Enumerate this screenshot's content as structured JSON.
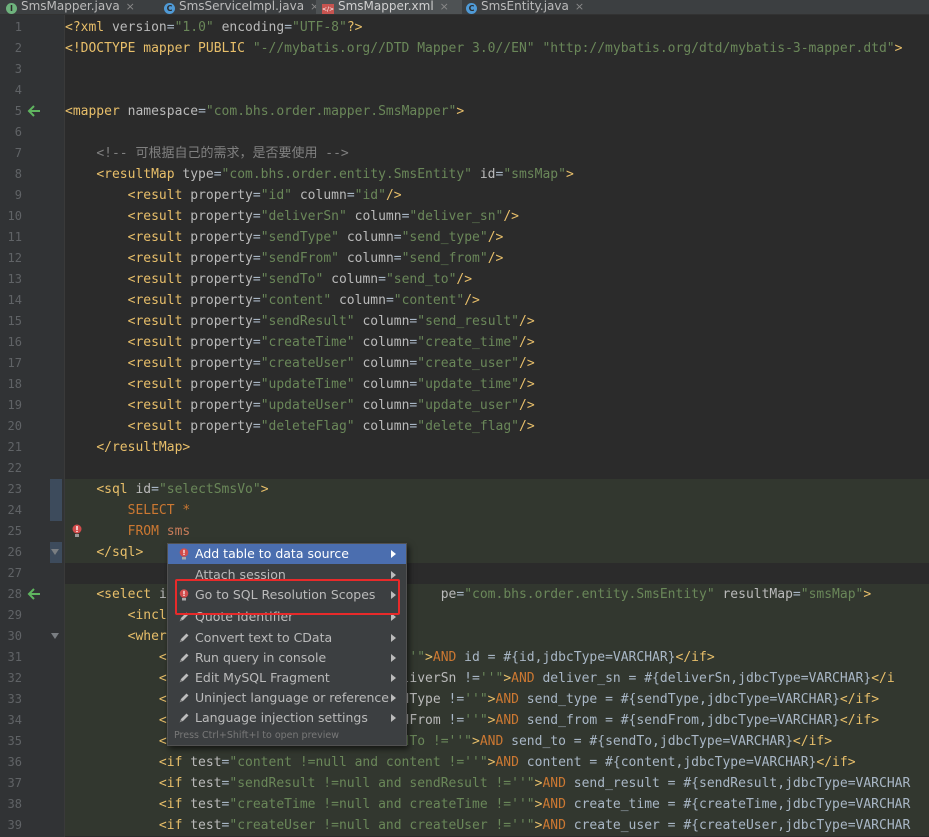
{
  "tabs": [
    {
      "label": "SmsMapper.java",
      "icon": "interface-icon",
      "icon_color": "#6eb37d",
      "icon_letter": "I",
      "active": false
    },
    {
      "label": "SmsServiceImpl.java",
      "icon": "class-icon",
      "icon_color": "#4f9ad6",
      "icon_letter": "C",
      "active": false
    },
    {
      "label": "SmsMapper.xml",
      "icon": "xml-file-icon",
      "icon_color": "#c75450",
      "icon_letter": "</>",
      "active": true
    },
    {
      "label": "SmsEntity.java",
      "icon": "class-icon",
      "icon_color": "#4f9ad6",
      "icon_letter": "C",
      "active": false
    }
  ],
  "line_numbers": [
    "1",
    "2",
    "3",
    "4",
    "5",
    "6",
    "7",
    "8",
    "9",
    "10",
    "11",
    "12",
    "13",
    "14",
    "15",
    "16",
    "17",
    "18",
    "19",
    "20",
    "21",
    "22",
    "23",
    "24",
    "25",
    "26",
    "27",
    "28",
    "29",
    "30",
    "31",
    "32",
    "33",
    "34",
    "35",
    "36",
    "37",
    "38",
    "39"
  ],
  "code_lines": [
    [
      [
        "t-tag",
        "<?xml "
      ],
      [
        "t-attr",
        "version"
      ],
      [
        "t-pl",
        "="
      ],
      [
        "t-val",
        "\"1.0\""
      ],
      [
        "t-pl",
        " "
      ],
      [
        "t-attr",
        "encoding"
      ],
      [
        "t-pl",
        "="
      ],
      [
        "t-val",
        "\"UTF-8\""
      ],
      [
        "t-tag",
        "?>"
      ]
    ],
    [
      [
        "t-tag",
        "<!DOCTYPE mapper PUBLIC "
      ],
      [
        "t-val",
        "\"-//mybatis.org//DTD Mapper 3.0//EN\""
      ],
      [
        "t-pl",
        " "
      ],
      [
        "t-val",
        "\"http://mybatis.org/dtd/mybatis-3-mapper.dtd\""
      ],
      [
        "t-tag",
        ">"
      ]
    ],
    [],
    [],
    [
      [
        "t-tag",
        "<mapper "
      ],
      [
        "t-attr",
        "namespace"
      ],
      [
        "t-pl",
        "="
      ],
      [
        "t-val",
        "\"com.bhs.order.mapper.SmsMapper\""
      ],
      [
        "t-tag",
        ">"
      ]
    ],
    [],
    [
      [
        "t-pl",
        "    "
      ],
      [
        "t-com",
        "<!-- 可根据自己的需求，是否要使用 -->"
      ]
    ],
    [
      [
        "t-pl",
        "    "
      ],
      [
        "t-tag",
        "<resultMap "
      ],
      [
        "t-attr",
        "type"
      ],
      [
        "t-pl",
        "="
      ],
      [
        "t-val",
        "\"com.bhs.order.entity.SmsEntity\""
      ],
      [
        "t-pl",
        " "
      ],
      [
        "t-attr",
        "id"
      ],
      [
        "t-pl",
        "="
      ],
      [
        "t-val",
        "\"smsMap\""
      ],
      [
        "t-tag",
        ">"
      ]
    ],
    [
      [
        "t-pl",
        "        "
      ],
      [
        "t-tag",
        "<result "
      ],
      [
        "t-attr",
        "property"
      ],
      [
        "t-pl",
        "="
      ],
      [
        "t-val",
        "\"id\""
      ],
      [
        "t-pl",
        " "
      ],
      [
        "t-attr",
        "column"
      ],
      [
        "t-pl",
        "="
      ],
      [
        "t-val",
        "\"id\""
      ],
      [
        "t-tag",
        "/>"
      ]
    ],
    [
      [
        "t-pl",
        "        "
      ],
      [
        "t-tag",
        "<result "
      ],
      [
        "t-attr",
        "property"
      ],
      [
        "t-pl",
        "="
      ],
      [
        "t-val",
        "\"deliverSn\""
      ],
      [
        "t-pl",
        " "
      ],
      [
        "t-attr",
        "column"
      ],
      [
        "t-pl",
        "="
      ],
      [
        "t-val",
        "\"deliver_sn\""
      ],
      [
        "t-tag",
        "/>"
      ]
    ],
    [
      [
        "t-pl",
        "        "
      ],
      [
        "t-tag",
        "<result "
      ],
      [
        "t-attr",
        "property"
      ],
      [
        "t-pl",
        "="
      ],
      [
        "t-val",
        "\"sendType\""
      ],
      [
        "t-pl",
        " "
      ],
      [
        "t-attr",
        "column"
      ],
      [
        "t-pl",
        "="
      ],
      [
        "t-val",
        "\"send_type\""
      ],
      [
        "t-tag",
        "/>"
      ]
    ],
    [
      [
        "t-pl",
        "        "
      ],
      [
        "t-tag",
        "<result "
      ],
      [
        "t-attr",
        "property"
      ],
      [
        "t-pl",
        "="
      ],
      [
        "t-val",
        "\"sendFrom\""
      ],
      [
        "t-pl",
        " "
      ],
      [
        "t-attr",
        "column"
      ],
      [
        "t-pl",
        "="
      ],
      [
        "t-val",
        "\"send_from\""
      ],
      [
        "t-tag",
        "/>"
      ]
    ],
    [
      [
        "t-pl",
        "        "
      ],
      [
        "t-tag",
        "<result "
      ],
      [
        "t-attr",
        "property"
      ],
      [
        "t-pl",
        "="
      ],
      [
        "t-val",
        "\"sendTo\""
      ],
      [
        "t-pl",
        " "
      ],
      [
        "t-attr",
        "column"
      ],
      [
        "t-pl",
        "="
      ],
      [
        "t-val",
        "\"send_to\""
      ],
      [
        "t-tag",
        "/>"
      ]
    ],
    [
      [
        "t-pl",
        "        "
      ],
      [
        "t-tag",
        "<result "
      ],
      [
        "t-attr",
        "property"
      ],
      [
        "t-pl",
        "="
      ],
      [
        "t-val",
        "\"content\""
      ],
      [
        "t-pl",
        " "
      ],
      [
        "t-attr",
        "column"
      ],
      [
        "t-pl",
        "="
      ],
      [
        "t-val",
        "\"content\""
      ],
      [
        "t-tag",
        "/>"
      ]
    ],
    [
      [
        "t-pl",
        "        "
      ],
      [
        "t-tag",
        "<result "
      ],
      [
        "t-attr",
        "property"
      ],
      [
        "t-pl",
        "="
      ],
      [
        "t-val",
        "\"sendResult\""
      ],
      [
        "t-pl",
        " "
      ],
      [
        "t-attr",
        "column"
      ],
      [
        "t-pl",
        "="
      ],
      [
        "t-val",
        "\"send_result\""
      ],
      [
        "t-tag",
        "/>"
      ]
    ],
    [
      [
        "t-pl",
        "        "
      ],
      [
        "t-tag",
        "<result "
      ],
      [
        "t-attr",
        "property"
      ],
      [
        "t-pl",
        "="
      ],
      [
        "t-val",
        "\"createTime\""
      ],
      [
        "t-pl",
        " "
      ],
      [
        "t-attr",
        "column"
      ],
      [
        "t-pl",
        "="
      ],
      [
        "t-val",
        "\"create_time\""
      ],
      [
        "t-tag",
        "/>"
      ]
    ],
    [
      [
        "t-pl",
        "        "
      ],
      [
        "t-tag",
        "<result "
      ],
      [
        "t-attr",
        "property"
      ],
      [
        "t-pl",
        "="
      ],
      [
        "t-val",
        "\"createUser\""
      ],
      [
        "t-pl",
        " "
      ],
      [
        "t-attr",
        "column"
      ],
      [
        "t-pl",
        "="
      ],
      [
        "t-val",
        "\"create_user\""
      ],
      [
        "t-tag",
        "/>"
      ]
    ],
    [
      [
        "t-pl",
        "        "
      ],
      [
        "t-tag",
        "<result "
      ],
      [
        "t-attr",
        "property"
      ],
      [
        "t-pl",
        "="
      ],
      [
        "t-val",
        "\"updateTime\""
      ],
      [
        "t-pl",
        " "
      ],
      [
        "t-attr",
        "column"
      ],
      [
        "t-pl",
        "="
      ],
      [
        "t-val",
        "\"update_time\""
      ],
      [
        "t-tag",
        "/>"
      ]
    ],
    [
      [
        "t-pl",
        "        "
      ],
      [
        "t-tag",
        "<result "
      ],
      [
        "t-attr",
        "property"
      ],
      [
        "t-pl",
        "="
      ],
      [
        "t-val",
        "\"updateUser\""
      ],
      [
        "t-pl",
        " "
      ],
      [
        "t-attr",
        "column"
      ],
      [
        "t-pl",
        "="
      ],
      [
        "t-val",
        "\"update_user\""
      ],
      [
        "t-tag",
        "/>"
      ]
    ],
    [
      [
        "t-pl",
        "        "
      ],
      [
        "t-tag",
        "<result "
      ],
      [
        "t-attr",
        "property"
      ],
      [
        "t-pl",
        "="
      ],
      [
        "t-val",
        "\"deleteFlag\""
      ],
      [
        "t-pl",
        " "
      ],
      [
        "t-attr",
        "column"
      ],
      [
        "t-pl",
        "="
      ],
      [
        "t-val",
        "\"delete_flag\""
      ],
      [
        "t-tag",
        "/>"
      ]
    ],
    [
      [
        "t-pl",
        "    "
      ],
      [
        "t-tag",
        "</resultMap>"
      ]
    ],
    [],
    [
      [
        "t-pl",
        "    "
      ],
      [
        "t-tag",
        "<sql "
      ],
      [
        "t-attr",
        "id"
      ],
      [
        "t-pl",
        "="
      ],
      [
        "t-val",
        "\"selectSmsVo\""
      ],
      [
        "t-tag",
        ">"
      ]
    ],
    [
      [
        "t-pl",
        "        "
      ],
      [
        "t-kw",
        "SELECT"
      ],
      [
        "t-pl",
        " "
      ],
      [
        "t-kw",
        "*"
      ]
    ],
    [
      [
        "t-pl",
        "        "
      ],
      [
        "t-kw",
        "FROM"
      ],
      [
        "t-pl",
        " "
      ],
      [
        "t-tbl",
        "sms"
      ]
    ],
    [
      [
        "t-pl",
        "    "
      ],
      [
        "t-tag",
        "</sql>"
      ]
    ],
    [],
    [
      [
        "t-pl",
        "    "
      ],
      [
        "t-tag",
        "<select "
      ],
      [
        "t-attr",
        "i"
      ],
      [
        "t-pl",
        "                                   "
      ],
      [
        "t-attr",
        "pe"
      ],
      [
        "t-pl",
        "="
      ],
      [
        "t-val",
        "\"com.bhs.order.entity.SmsEntity\""
      ],
      [
        "t-pl",
        " "
      ],
      [
        "t-attr",
        "resultMap"
      ],
      [
        "t-pl",
        "="
      ],
      [
        "t-val",
        "\"smsMap\""
      ],
      [
        "t-tag",
        ">"
      ]
    ],
    [
      [
        "t-pl",
        "        "
      ],
      [
        "t-tag",
        "<incl"
      ]
    ],
    [
      [
        "t-pl",
        "        "
      ],
      [
        "t-tag",
        "<wher"
      ]
    ],
    [
      [
        "t-pl",
        "            "
      ],
      [
        "t-tag",
        "<"
      ],
      [
        "t-pl",
        "                               "
      ],
      [
        "t-val",
        "'\""
      ],
      [
        "t-tag",
        ">"
      ],
      [
        "t-kw",
        "AND"
      ],
      [
        "t-pl",
        " id = #{id,jdbcType=VARCHAR}"
      ],
      [
        "t-tag",
        "</if>"
      ]
    ],
    [
      [
        "t-pl",
        "            "
      ],
      [
        "t-tag",
        "<"
      ],
      [
        "t-pl",
        "                            "
      ],
      [
        "t-attr",
        "deliverSn"
      ],
      [
        "t-pl",
        " !="
      ],
      [
        "t-val",
        "''\""
      ],
      [
        "t-tag",
        ">"
      ],
      [
        "t-kw",
        "AND"
      ],
      [
        "t-pl",
        " deliver_sn = #{deliverSn,jdbcType=VARCHAR}"
      ],
      [
        "t-tag",
        "</i"
      ]
    ],
    [
      [
        "t-pl",
        "            "
      ],
      [
        "t-tag",
        "<"
      ],
      [
        "t-pl",
        "                            "
      ],
      [
        "t-attr",
        "endType"
      ],
      [
        "t-pl",
        " !="
      ],
      [
        "t-val",
        "''\""
      ],
      [
        "t-tag",
        ">"
      ],
      [
        "t-kw",
        "AND"
      ],
      [
        "t-pl",
        " send_type = #{sendType,jdbcType=VARCHAR}"
      ],
      [
        "t-tag",
        "</if>"
      ]
    ],
    [
      [
        "t-pl",
        "            "
      ],
      [
        "t-tag",
        "<"
      ],
      [
        "t-pl",
        "                            "
      ],
      [
        "t-attr",
        "endFrom"
      ],
      [
        "t-pl",
        " !="
      ],
      [
        "t-val",
        "''\""
      ],
      [
        "t-tag",
        ">"
      ],
      [
        "t-kw",
        "AND"
      ],
      [
        "t-pl",
        " send_from = #{sendFrom,jdbcType=VARCHAR}"
      ],
      [
        "t-tag",
        "</if>"
      ]
    ],
    [
      [
        "t-pl",
        "            "
      ],
      [
        "t-tag",
        "<if "
      ],
      [
        "t-attr",
        "test"
      ],
      [
        "t-pl",
        "="
      ],
      [
        "t-val",
        "\"sendTo !=null and sendTo !=''\""
      ],
      [
        "t-tag",
        ">"
      ],
      [
        "t-kw",
        "AND"
      ],
      [
        "t-pl",
        " send_to = #{sendTo,jdbcType=VARCHAR}"
      ],
      [
        "t-tag",
        "</if>"
      ]
    ],
    [
      [
        "t-pl",
        "            "
      ],
      [
        "t-tag",
        "<if "
      ],
      [
        "t-attr",
        "test"
      ],
      [
        "t-pl",
        "="
      ],
      [
        "t-val",
        "\"content !=null and content !=''\""
      ],
      [
        "t-tag",
        ">"
      ],
      [
        "t-kw",
        "AND"
      ],
      [
        "t-pl",
        " content = #{content,jdbcType=VARCHAR}"
      ],
      [
        "t-tag",
        "</if>"
      ]
    ],
    [
      [
        "t-pl",
        "            "
      ],
      [
        "t-tag",
        "<if "
      ],
      [
        "t-attr",
        "test"
      ],
      [
        "t-pl",
        "="
      ],
      [
        "t-val",
        "\"sendResult !=null and sendResult !=''\""
      ],
      [
        "t-tag",
        ">"
      ],
      [
        "t-kw",
        "AND"
      ],
      [
        "t-pl",
        " send_result = #{sendResult,jdbcType=VARCHAR"
      ]
    ],
    [
      [
        "t-pl",
        "            "
      ],
      [
        "t-tag",
        "<if "
      ],
      [
        "t-attr",
        "test"
      ],
      [
        "t-pl",
        "="
      ],
      [
        "t-val",
        "\"createTime !=null and createTime !=''\""
      ],
      [
        "t-tag",
        ">"
      ],
      [
        "t-kw",
        "AND"
      ],
      [
        "t-pl",
        " create_time = #{createTime,jdbcType=VARCHAR"
      ]
    ],
    [
      [
        "t-pl",
        "            "
      ],
      [
        "t-tag",
        "<if "
      ],
      [
        "t-attr",
        "test"
      ],
      [
        "t-pl",
        "="
      ],
      [
        "t-val",
        "\"createUser !=null and createUser !=''\""
      ],
      [
        "t-tag",
        ">"
      ],
      [
        "t-kw",
        "AND"
      ],
      [
        "t-pl",
        " create_user = #{createUser,jdbcType=VARCHAR"
      ]
    ]
  ],
  "context_menu": {
    "items": [
      {
        "label": "Add table to data source",
        "icon": "error-bulb-icon",
        "submenu": true,
        "selected": true
      },
      {
        "label": "Attach session",
        "icon": "",
        "submenu": true,
        "selected": false
      },
      {
        "label": "Go to SQL Resolution Scopes",
        "icon": "error-bulb-icon",
        "submenu": true,
        "selected": false
      },
      {
        "label": "Quote Identifier",
        "icon": "pencil-icon",
        "submenu": true,
        "selected": false
      },
      {
        "label": "Convert text to CData",
        "icon": "pencil-icon",
        "submenu": true,
        "selected": false
      },
      {
        "label": "Run query in console",
        "icon": "pencil-icon",
        "submenu": true,
        "selected": false
      },
      {
        "label": "Edit MySQL Fragment",
        "icon": "pencil-icon",
        "submenu": true,
        "selected": false
      },
      {
        "label": "Uninject language or reference",
        "icon": "pencil-icon",
        "submenu": true,
        "selected": false
      },
      {
        "label": "Language injection settings",
        "icon": "pencil-icon",
        "submenu": true,
        "selected": false
      }
    ],
    "hint": "Press Ctrl+Shift+I to open preview"
  },
  "colors": {
    "selection": "#4b6eaf",
    "highlight_box": "#e82a2a"
  }
}
